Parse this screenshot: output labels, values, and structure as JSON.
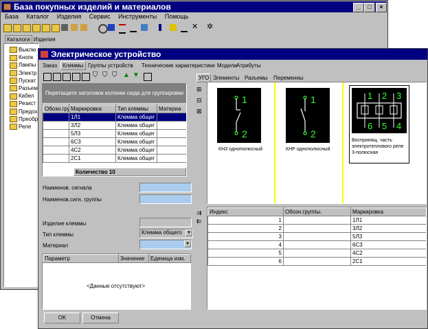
{
  "back_window": {
    "title": "База покупных изделий и материалов",
    "menu": [
      "База",
      "Каталог",
      "Изделия",
      "Сервис",
      "Инструменты",
      "Помощь"
    ],
    "tabs": [
      "Каталоги",
      "Изделия"
    ],
    "tree_items": [
      "Выклю",
      "Кнопк",
      "Лампы",
      "Электр",
      "Пускат",
      "Разъем",
      "Кабел",
      "Резист",
      "Предох",
      "Преобр",
      "Реле"
    ]
  },
  "dialog": {
    "title": "Электрическое устройство",
    "tabs": [
      "Заказ",
      "Клеммы",
      "Группы устройств",
      "Технические характеристики",
      "Модели",
      "Атрибуты"
    ],
    "group_hint": "Перетащите заголовок колонки сюда для группировки",
    "terminals_table": {
      "columns": [
        "Обозн.группы",
        "Маркировка",
        "Тип клеммы",
        "Материа"
      ],
      "rows": [
        [
          "",
          "1Л1",
          "Клемма общег",
          ""
        ],
        [
          "",
          "3Л2",
          "Клемма общег",
          ""
        ],
        [
          "",
          "5Л3",
          "Клемма общег",
          ""
        ],
        [
          "",
          "6С3",
          "Клемма общег",
          ""
        ],
        [
          "",
          "4С2",
          "Клемма общег",
          ""
        ],
        [
          "",
          "2С1",
          "Клемма общег",
          ""
        ]
      ],
      "count_label": "Количество 10"
    },
    "fields": {
      "signal_name_label": "Наименов. сигнала",
      "signal_group_label": "Наименов.сигн. группы",
      "terminal_item_label": "Изделие клеммы",
      "terminal_type_label": "Тип клеммы",
      "terminal_type_value": "Клемма общего",
      "material_label": "Материал"
    },
    "params_table": {
      "columns": [
        "Параметр",
        "Значение",
        "Единица изм."
      ],
      "empty_text": "<Данные отсутствуют>"
    },
    "buttons": {
      "ok": "OK",
      "cancel": "Отмена"
    },
    "right_tabs": [
      "УГО",
      "Элементы",
      "Разъемы",
      "Переменны"
    ],
    "symbols": [
      {
        "caption": "КНЗ однополюсный",
        "pin_top": "1",
        "pin_bottom": "2"
      },
      {
        "caption": "КНР однополюсный",
        "pin_top": "1",
        "pin_bottom": "2"
      },
      {
        "caption": "Воспринящ. часть электротеплового реле 3-полюсная",
        "pins_top": [
          "1",
          "2",
          "3"
        ],
        "pins_bottom": [
          "6",
          "5",
          "4"
        ]
      }
    ],
    "elements_table": {
      "columns": [
        "Индекс",
        "Обозн.группы.",
        "Маркировка"
      ],
      "rows": [
        [
          "1",
          "",
          "1Л1"
        ],
        [
          "2",
          "",
          "3Л2"
        ],
        [
          "3",
          "",
          "5Л3"
        ],
        [
          "4",
          "",
          "6С3"
        ],
        [
          "5",
          "",
          "4С2"
        ],
        [
          "6",
          "",
          "2С1"
        ]
      ]
    }
  },
  "colors": {
    "title_bar": "#000080",
    "field_blue": "#aaccee",
    "symbol_bg": "#000000",
    "symbol_line": "#33ff33",
    "divider_yellow": "#ffff00"
  }
}
